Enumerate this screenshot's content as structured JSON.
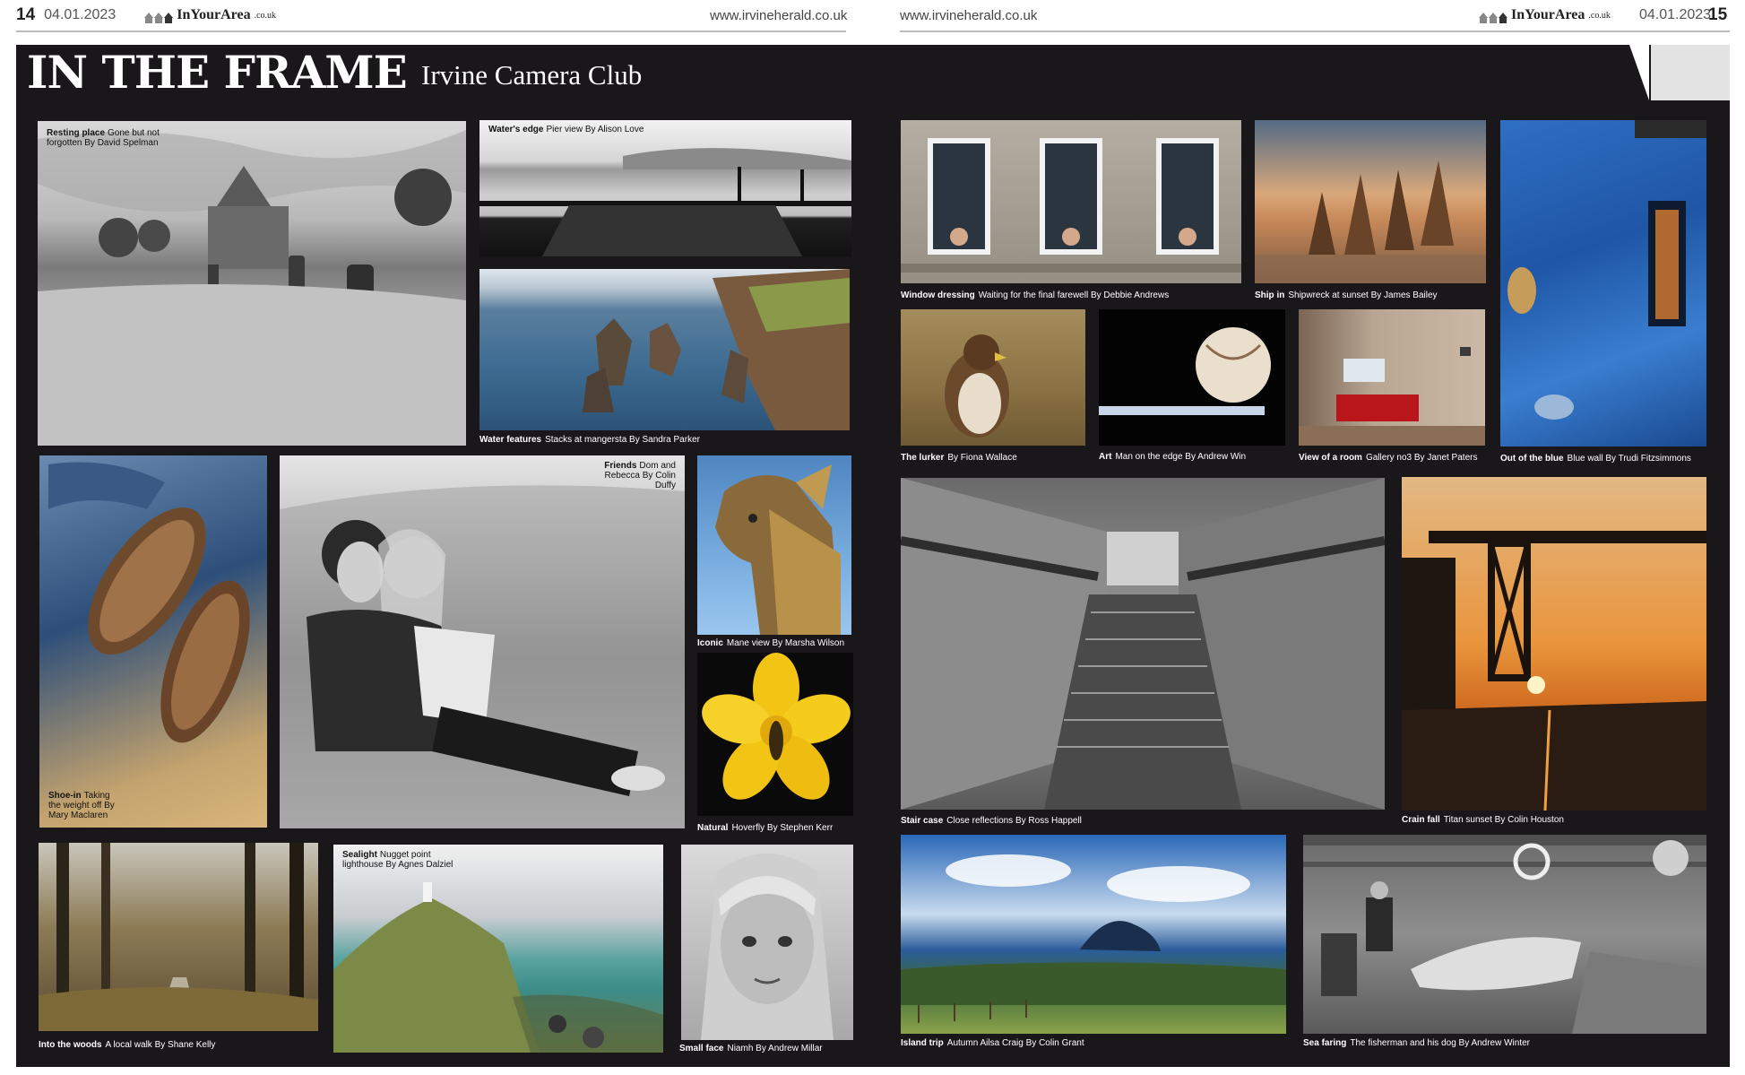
{
  "left_folio": {
    "page": "14",
    "date": "04.01.2023",
    "brand": "InYourArea",
    "brand_suffix": ".co.uk",
    "url": "www.irvineherald.co.uk"
  },
  "right_folio": {
    "page": "15",
    "date": "04.01.2023",
    "brand": "InYourArea",
    "brand_suffix": ".co.uk",
    "url": "www.irvineherald.co.uk"
  },
  "header": {
    "title": "IN THE FRAME",
    "subtitle": "Irvine Camera Club"
  },
  "photos": {
    "resting": {
      "title": "Resting place",
      "desc": "Gone but not forgotten By David Spelman"
    },
    "waters_edge": {
      "title": "Water's edge",
      "desc": "Pier view By Alison Love"
    },
    "water_features": {
      "title": "Water features",
      "desc": "Stacks at mangersta By Sandra Parker"
    },
    "shoe_in": {
      "title": "Shoe-in",
      "desc": "Taking the weight off By Mary Maclaren"
    },
    "friends": {
      "title": "Friends",
      "desc": "Dom and Rebecca By Colin Duffy"
    },
    "iconic": {
      "title": "Iconic",
      "desc": "Mane view By Marsha Wilson"
    },
    "natural": {
      "title": "Natural",
      "desc": "Hoverfly By Stephen Kerr"
    },
    "woods": {
      "title": "Into the woods",
      "desc": "A local walk By Shane Kelly"
    },
    "sealight": {
      "title": "Sealight",
      "desc": "Nugget point lighthouse By Agnes Dalziel"
    },
    "small_face": {
      "title": "Small face",
      "desc": "Niamh By Andrew Millar"
    },
    "window": {
      "title": "Window dressing",
      "desc": "Waiting for the final farewell By Debbie Andrews"
    },
    "ship": {
      "title": "Ship in",
      "desc": "Shipwreck at sunset By James Bailey"
    },
    "blue": {
      "title": "Out of the blue",
      "desc": "Blue wall By Trudi Fitzsimmons"
    },
    "lurker": {
      "title": "The lurker",
      "desc": "By Fiona Wallace"
    },
    "art": {
      "title": "Art",
      "desc": "Man on the edge By Andrew Win"
    },
    "room": {
      "title": "View of a room",
      "desc": "Gallery no3 By Janet Paters"
    },
    "stair": {
      "title": "Stair case",
      "desc": "Close reflections By Ross Happell"
    },
    "crain": {
      "title": "Crain fall",
      "desc": "Titan sunset By Colin Houston"
    },
    "island": {
      "title": "Island trip",
      "desc": "Autumn Ailsa Craig By Colin Grant"
    },
    "sea": {
      "title": "Sea faring",
      "desc": "The fisherman and his dog By Andrew Winter"
    }
  }
}
